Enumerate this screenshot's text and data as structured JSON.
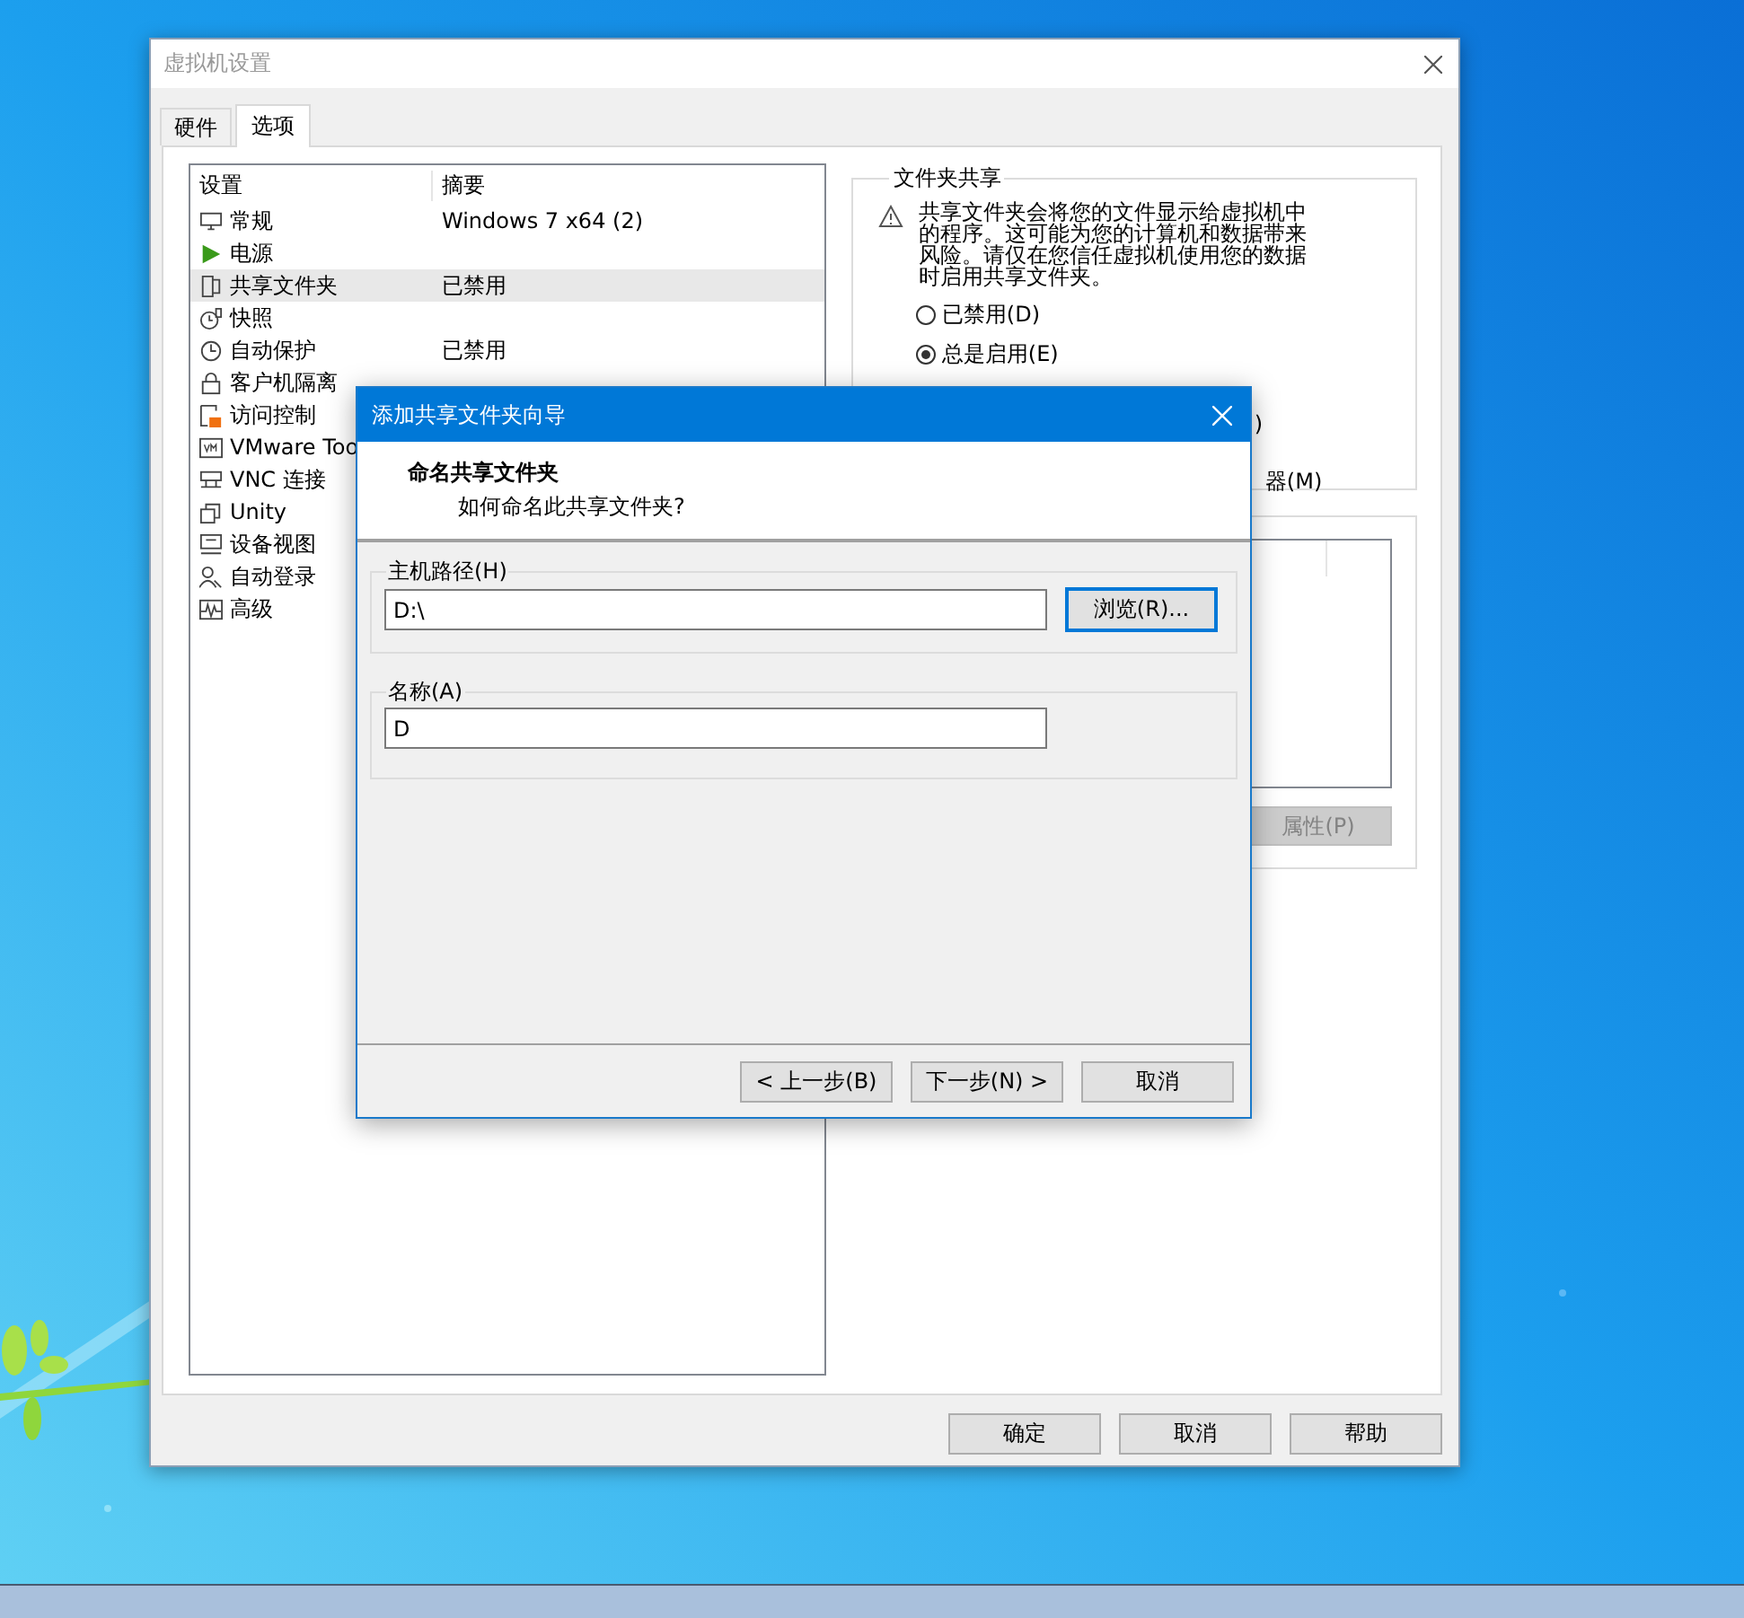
{
  "settings_window": {
    "title": "虚拟机设置",
    "tabs": [
      {
        "label": "硬件",
        "selected": false
      },
      {
        "label": "选项",
        "selected": true
      }
    ],
    "settings_list": {
      "columns": [
        "设置",
        "摘要"
      ],
      "rows": [
        {
          "name": "常规",
          "summary": "Windows 7 x64 (2)",
          "selected": false
        },
        {
          "name": "电源",
          "selected": false
        },
        {
          "name": "共享文件夹",
          "summary": "已禁用",
          "selected": true
        },
        {
          "name": "快照",
          "selected": false
        },
        {
          "name": "自动保护",
          "summary": "已禁用",
          "selected": false
        },
        {
          "name": "客户机隔离",
          "selected": false
        },
        {
          "name": "访问控制",
          "selected": false
        },
        {
          "name": "VMware Too",
          "selected": false
        },
        {
          "name": "VNC 连接",
          "selected": false
        },
        {
          "name": "Unity",
          "selected": false
        },
        {
          "name": "设备视图",
          "selected": false
        },
        {
          "name": "自动登录",
          "selected": false
        },
        {
          "name": "高级",
          "selected": false
        }
      ]
    },
    "folder_sharing": {
      "title": "文件夹共享",
      "warning": "共享文件夹会将您的文件显示给虚拟机中的程序。这可能为您的计算机和数据带来风险。请仅在您信任虚拟机使用您的数据时启用共享文件夹。",
      "options": [
        {
          "label": "已禁用(D)",
          "selected": false
        },
        {
          "label": "总是启用(E)",
          "selected": true
        }
      ],
      "partly_covered_options": [
        ")",
        "器(M)"
      ]
    },
    "folders": {
      "properties_button": {
        "label": "属性(P)",
        "disabled": true
      }
    },
    "buttons": [
      {
        "label": "确定"
      },
      {
        "label": "取消"
      },
      {
        "label": "帮助"
      }
    ]
  },
  "wizard": {
    "title": "添加共享文件夹向导",
    "heading": "命名共享文件夹",
    "subheading": "如何命名此共享文件夹?",
    "host_path": {
      "label": "主机路径(H)",
      "value": "D:\\",
      "browse_button": "浏览(R)..."
    },
    "name": {
      "label": "名称(A)",
      "value": "D"
    },
    "buttons": [
      {
        "label": "< 上一步(B)"
      },
      {
        "label": "下一步(N) >"
      },
      {
        "label": "取消"
      }
    ]
  }
}
